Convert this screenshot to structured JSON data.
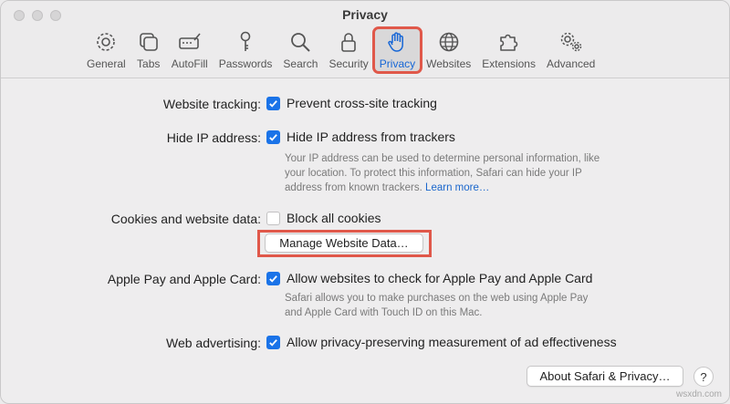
{
  "window": {
    "title": "Privacy"
  },
  "toolbar": {
    "tabs": [
      {
        "label": "General",
        "icon": "gear-icon"
      },
      {
        "label": "Tabs",
        "icon": "tabs-icon"
      },
      {
        "label": "AutoFill",
        "icon": "autofill-icon"
      },
      {
        "label": "Passwords",
        "icon": "key-icon"
      },
      {
        "label": "Search",
        "icon": "search-icon"
      },
      {
        "label": "Security",
        "icon": "lock-icon"
      },
      {
        "label": "Privacy",
        "icon": "hand-icon",
        "active": true
      },
      {
        "label": "Websites",
        "icon": "globe-icon"
      },
      {
        "label": "Extensions",
        "icon": "puzzle-icon"
      },
      {
        "label": "Advanced",
        "icon": "gears-icon"
      }
    ]
  },
  "settings": {
    "tracking": {
      "label": "Website tracking:",
      "option": "Prevent cross-site tracking",
      "checked": true
    },
    "hide_ip": {
      "label": "Hide IP address:",
      "option": "Hide IP address from trackers",
      "checked": true,
      "desc_1": "Your IP address can be used to determine personal information, like",
      "desc_2": "your location. To protect this information, Safari can hide your IP",
      "desc_3": "address from known trackers.",
      "link": "Learn more…"
    },
    "cookies": {
      "label": "Cookies and website data:",
      "option": "Block all cookies",
      "checked": false,
      "button": "Manage Website Data…"
    },
    "apple_pay": {
      "label": "Apple Pay and Apple Card:",
      "option": "Allow websites to check for Apple Pay and Apple Card",
      "checked": true,
      "desc_1": "Safari allows you to make purchases on the web using Apple Pay",
      "desc_2": "and Apple Card with Touch ID on this Mac."
    },
    "advertising": {
      "label": "Web advertising:",
      "option": "Allow privacy-preserving measurement of ad effectiveness",
      "checked": true
    }
  },
  "footer": {
    "about_button": "About Safari & Privacy…",
    "help": "?"
  },
  "watermark": "wsxdn.com",
  "colors": {
    "accent": "#1a73e8",
    "highlight": "#e0584a"
  }
}
